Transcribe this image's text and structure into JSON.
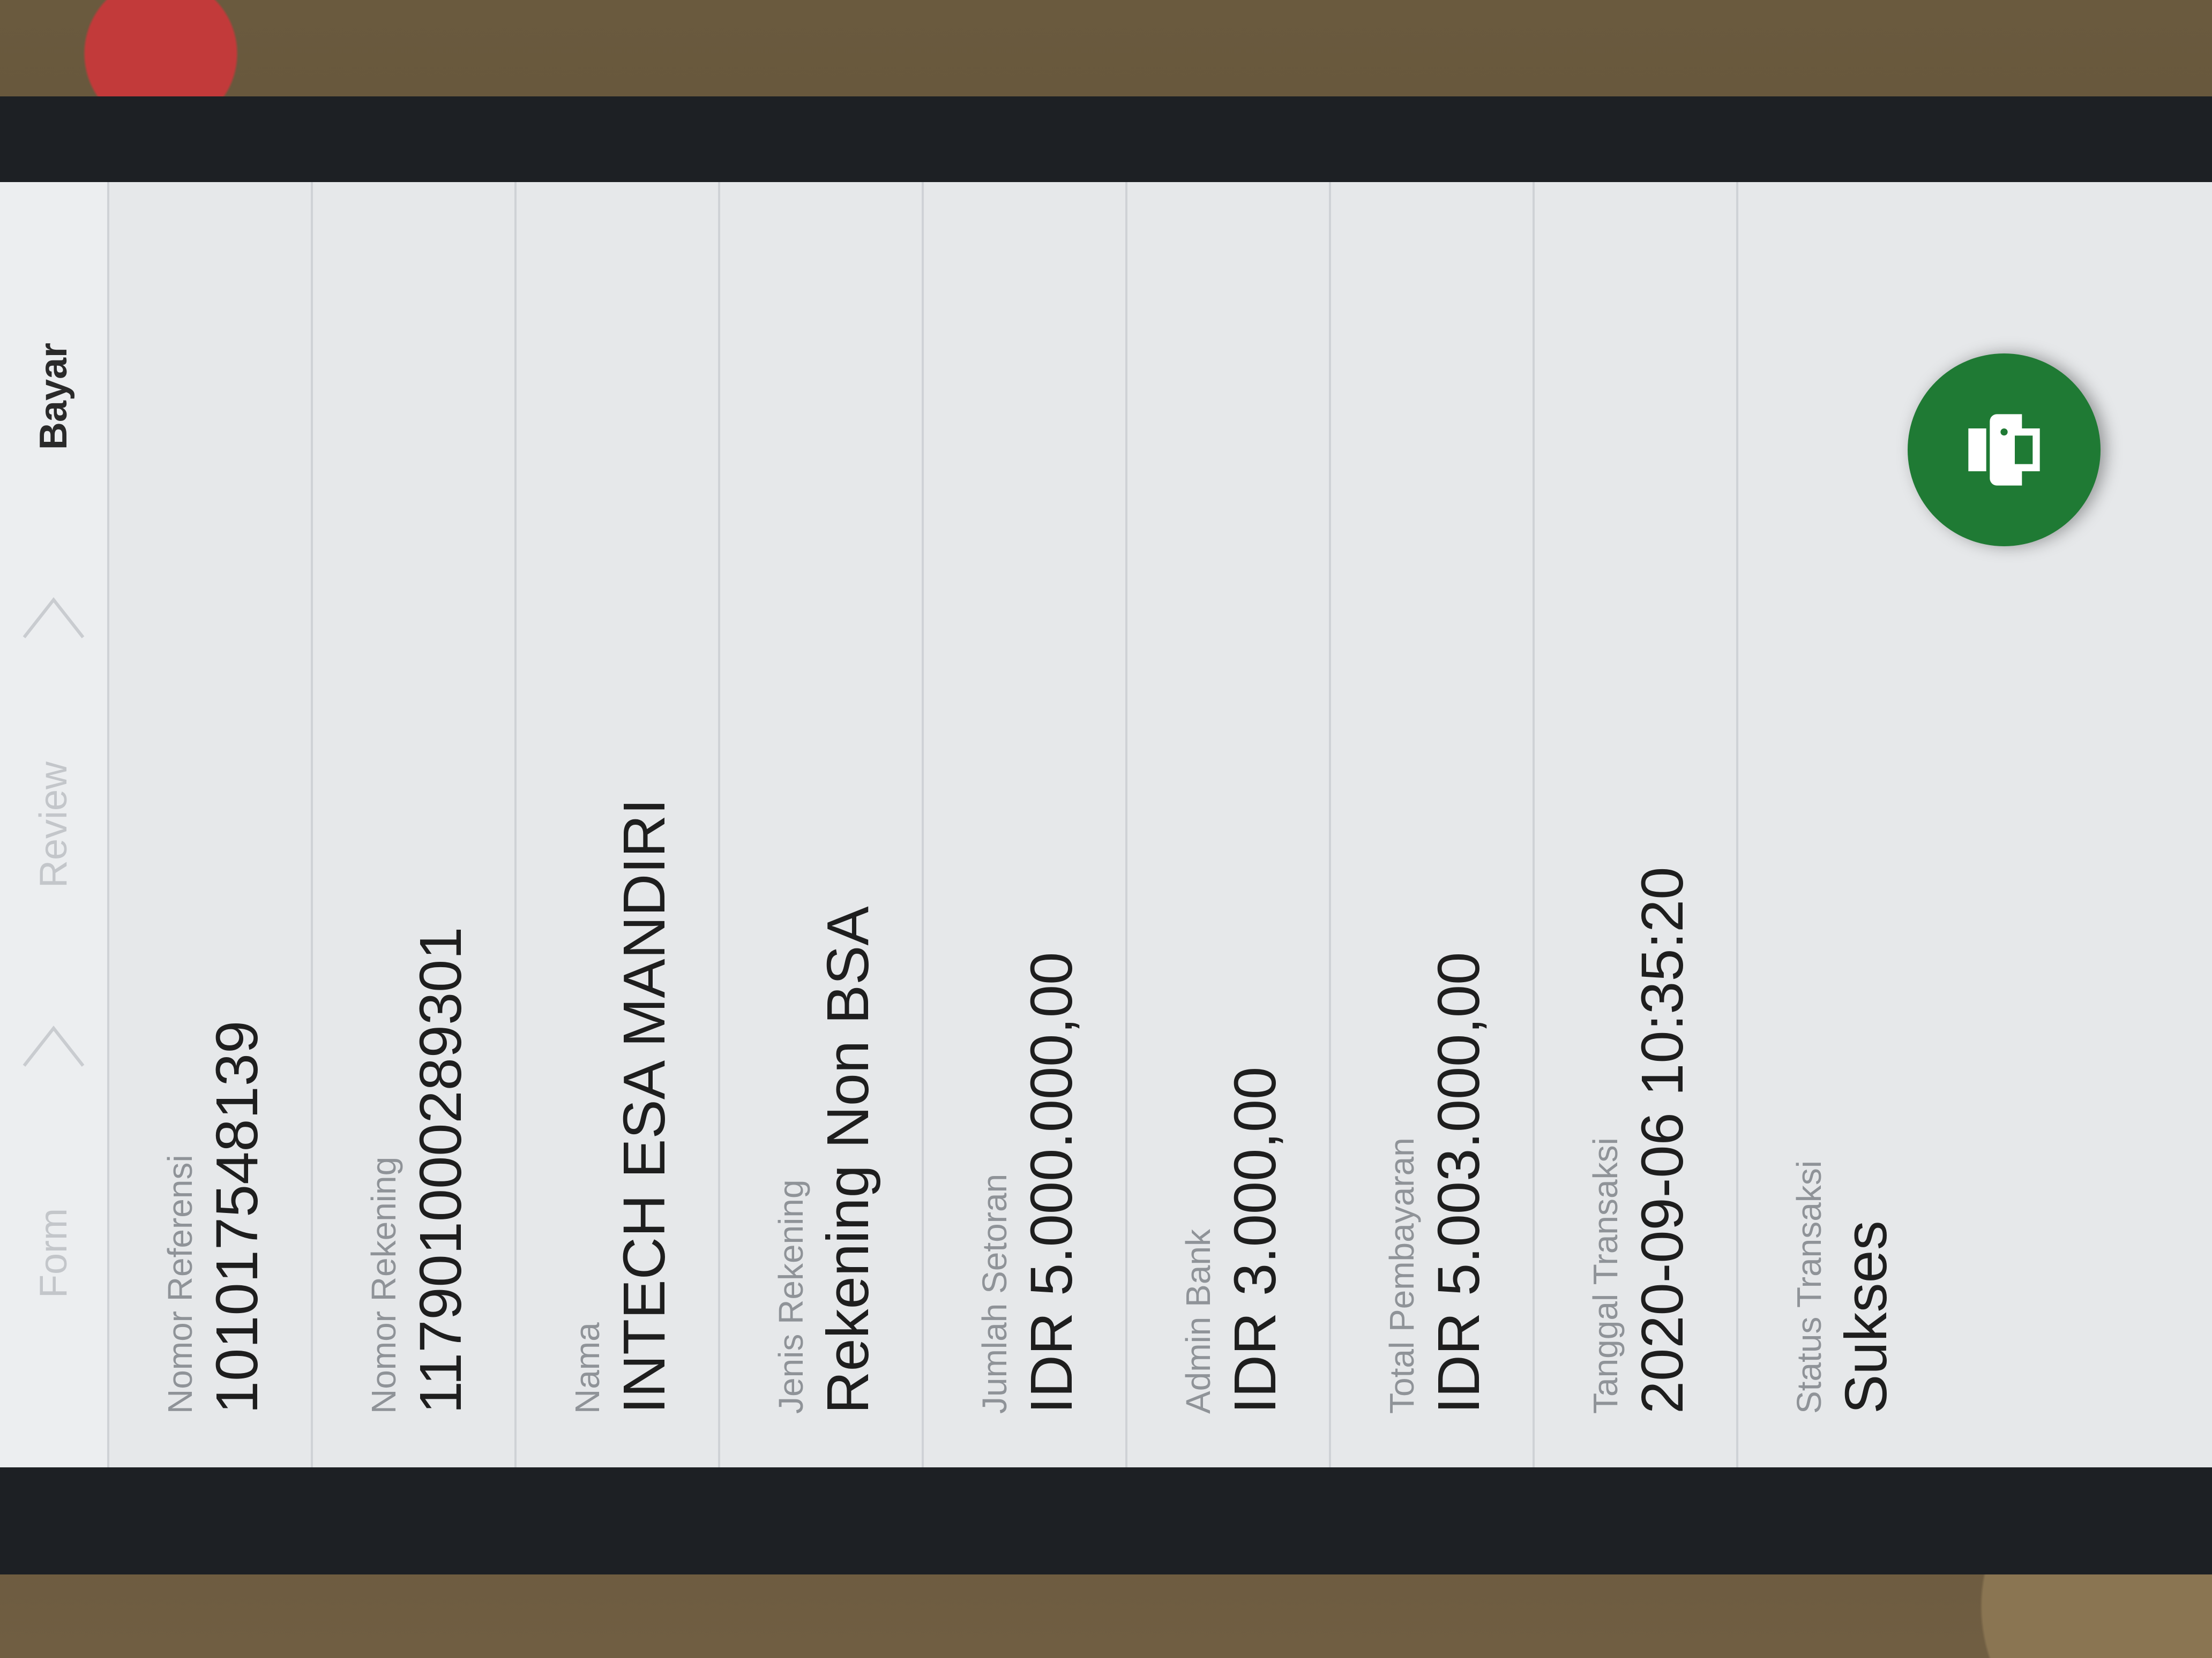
{
  "stepper": {
    "steps": [
      {
        "label": "Form"
      },
      {
        "label": "Review"
      },
      {
        "label": "Bayar"
      }
    ]
  },
  "details": [
    {
      "label": "Nomor Referensi",
      "value": "101017548139"
    },
    {
      "label": "Nomor Rekening",
      "value": "117901000289301"
    },
    {
      "label": "Nama",
      "value": "INTECH ESA MANDIRI"
    },
    {
      "label": "Jenis Rekening",
      "value": "Rekening Non BSA"
    },
    {
      "label": "Jumlah Setoran",
      "value": "IDR 5.000.000,00"
    },
    {
      "label": "Admin Bank",
      "value": "IDR 3.000,00"
    },
    {
      "label": "Total Pembayaran",
      "value": "IDR 5.003.000,00"
    },
    {
      "label": "Tanggal Transaksi",
      "value": "2020-09-06 10:35:20"
    },
    {
      "label": "Status Transaksi",
      "value": "Sukses"
    }
  ],
  "print_button": {
    "icon": "printer-icon",
    "color": "#1f7a34"
  }
}
